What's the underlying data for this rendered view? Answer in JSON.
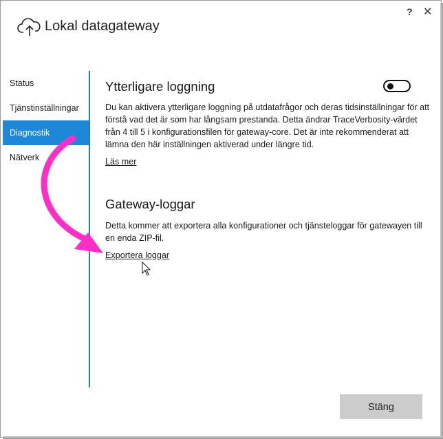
{
  "window": {
    "title": "Lokal datagateway",
    "help_label": "?",
    "close_label": "✕"
  },
  "sidebar": {
    "items": [
      {
        "label": "Status"
      },
      {
        "label": "Tjänstinställningar"
      },
      {
        "label": "Diagnostik"
      },
      {
        "label": "Nätverk"
      }
    ]
  },
  "logging": {
    "heading": "Ytterligare loggning",
    "description": "Du kan aktivera ytterligare loggning på utdatafrågor och deras tidsinställningar för att förstå vad det är som har långsam prestanda. Detta ändrar TraceVerbosity-värdet från 4 till 5 i konfigurationsfilen för gateway-core. Det är inte rekommenderat att lämna den här inställningen aktiverad under längre tid.",
    "learn_more": "Läs mer",
    "toggle_on": false
  },
  "gateway_logs": {
    "heading": "Gateway-loggar",
    "description": "Detta kommer att exportera alla konfigurationer och tjänsteloggar för gatewayen till en enda ZIP-fil.",
    "export_link": "Exportera loggar"
  },
  "footer": {
    "close_button": "Stäng"
  },
  "colors": {
    "accent": "#1e88d8",
    "annotation_arrow": "#ff2ec8"
  }
}
